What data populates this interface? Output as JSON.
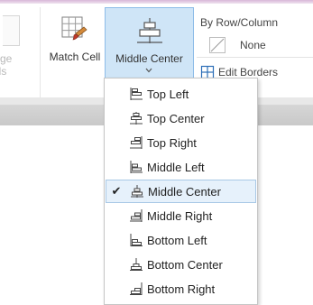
{
  "ribbon": {
    "merge_label_line1": "rge",
    "merge_label_line2": "lls",
    "match_cell_label": "Match Cell",
    "middle_center_label": "Middle Center",
    "by_row_column_label": "By Row/Column",
    "none_label": "None",
    "edit_borders_label": "Edit Borders"
  },
  "menu": {
    "selected_index": 4,
    "items": [
      {
        "label": "Top Left",
        "icon": "align-top-left-icon"
      },
      {
        "label": "Top Center",
        "icon": "align-top-center-icon"
      },
      {
        "label": "Top Right",
        "icon": "align-top-right-icon"
      },
      {
        "label": "Middle Left",
        "icon": "align-middle-left-icon"
      },
      {
        "label": "Middle Center",
        "icon": "align-middle-center-icon",
        "checked": true
      },
      {
        "label": "Middle Right",
        "icon": "align-middle-right-icon"
      },
      {
        "label": "Bottom Left",
        "icon": "align-bottom-left-icon"
      },
      {
        "label": "Bottom Center",
        "icon": "align-bottom-center-icon"
      },
      {
        "label": "Bottom Right",
        "icon": "align-bottom-right-icon"
      }
    ]
  },
  "colors": {
    "selected_bg": "#cfe5f7",
    "selected_border": "#8dbce8",
    "menu_selected_bg": "#e6f1fb"
  }
}
